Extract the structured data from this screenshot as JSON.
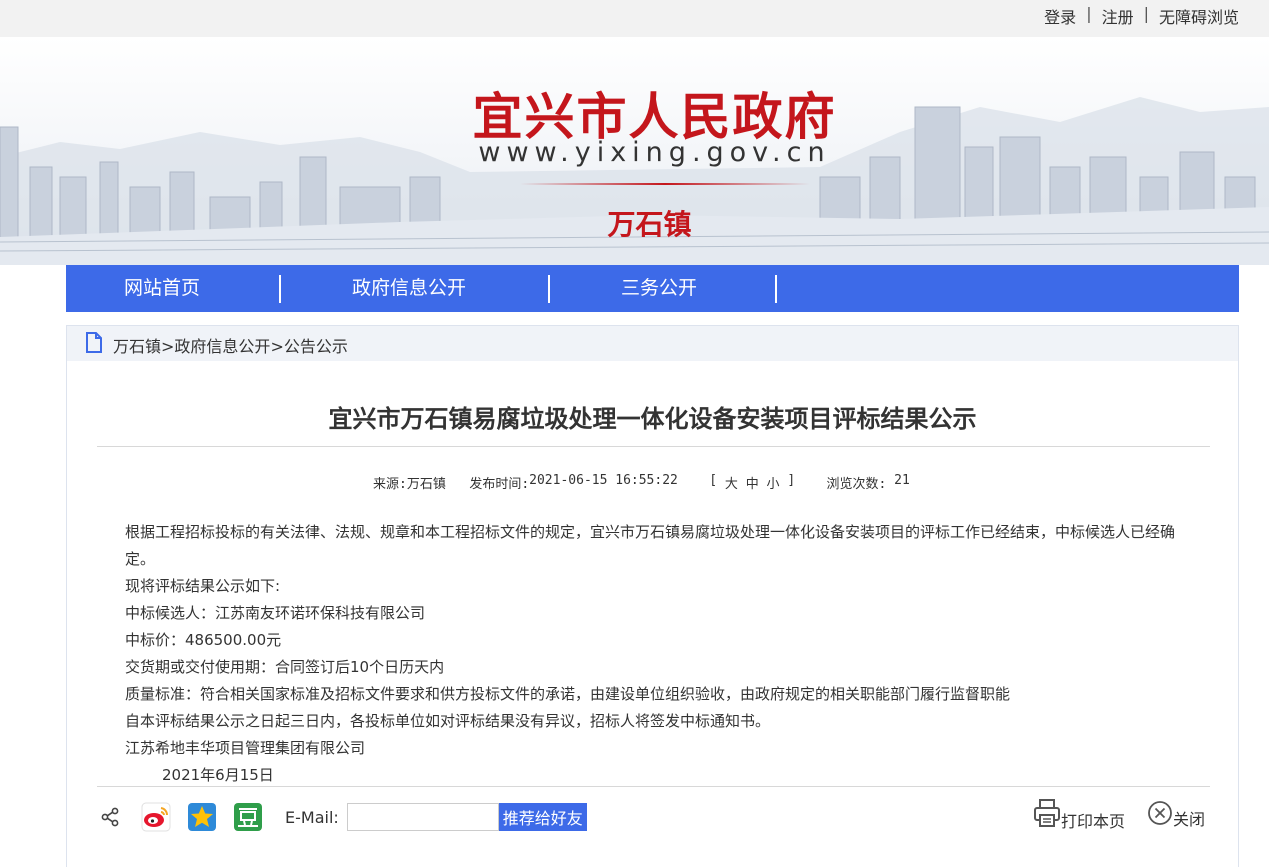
{
  "topbar": {
    "login": "登录",
    "register": "注册",
    "accessibility": "无障碍浏览",
    "separator": "|"
  },
  "banner": {
    "title": "宜兴市人民政府",
    "url": "www.yixing.gov.cn",
    "subtitle": "万石镇"
  },
  "nav": {
    "items": [
      "网站首页",
      "政府信息公开",
      "三务公开"
    ]
  },
  "breadcrumb": {
    "items": [
      "万石镇",
      "政府信息公开",
      "公告公示"
    ],
    "separator": ">"
  },
  "article": {
    "title": "宜兴市万石镇易腐垃圾处理一体化设备安装项目评标结果公示",
    "meta": {
      "source_label": "来源:",
      "source": "万石镇",
      "published_label": "发布时间:",
      "published": "2021-06-15 16:55:22",
      "bracket_open": "[",
      "size_large": "大",
      "size_medium": "中",
      "size_small": "小",
      "bracket_close": "]",
      "views_label": "浏览次数:",
      "views": "21"
    },
    "paragraphs": [
      "根据工程招标投标的有关法律、法规、规章和本工程招标文件的规定，宜兴市万石镇易腐垃圾处理一体化设备安装项目的评标工作已经结束，中标候选人已经确定。",
      "现将评标结果公示如下:",
      "中标候选人：江苏南友环诺环保科技有限公司",
      "中标价：486500.00元",
      "交货期或交付使用期：合同签订后10个日历天内",
      "质量标准：符合相关国家标准及招标文件要求和供方投标文件的承诺，由建设单位组织验收，由政府规定的相关职能部门履行监督职能",
      "自本评标结果公示之日起三日内，各投标单位如对评标结果没有异议，招标人将签发中标通知书。",
      "江苏希地丰华项目管理集团有限公司"
    ],
    "date": "2021年6月15日"
  },
  "share": {
    "email_label": "E-Mail:",
    "email_value": "",
    "recommend_label": "推荐给好友",
    "print_label": "打印本页",
    "close_label": "关闭"
  },
  "colors": {
    "brand_red": "#c4161c",
    "nav_blue": "#3d6ae8"
  }
}
